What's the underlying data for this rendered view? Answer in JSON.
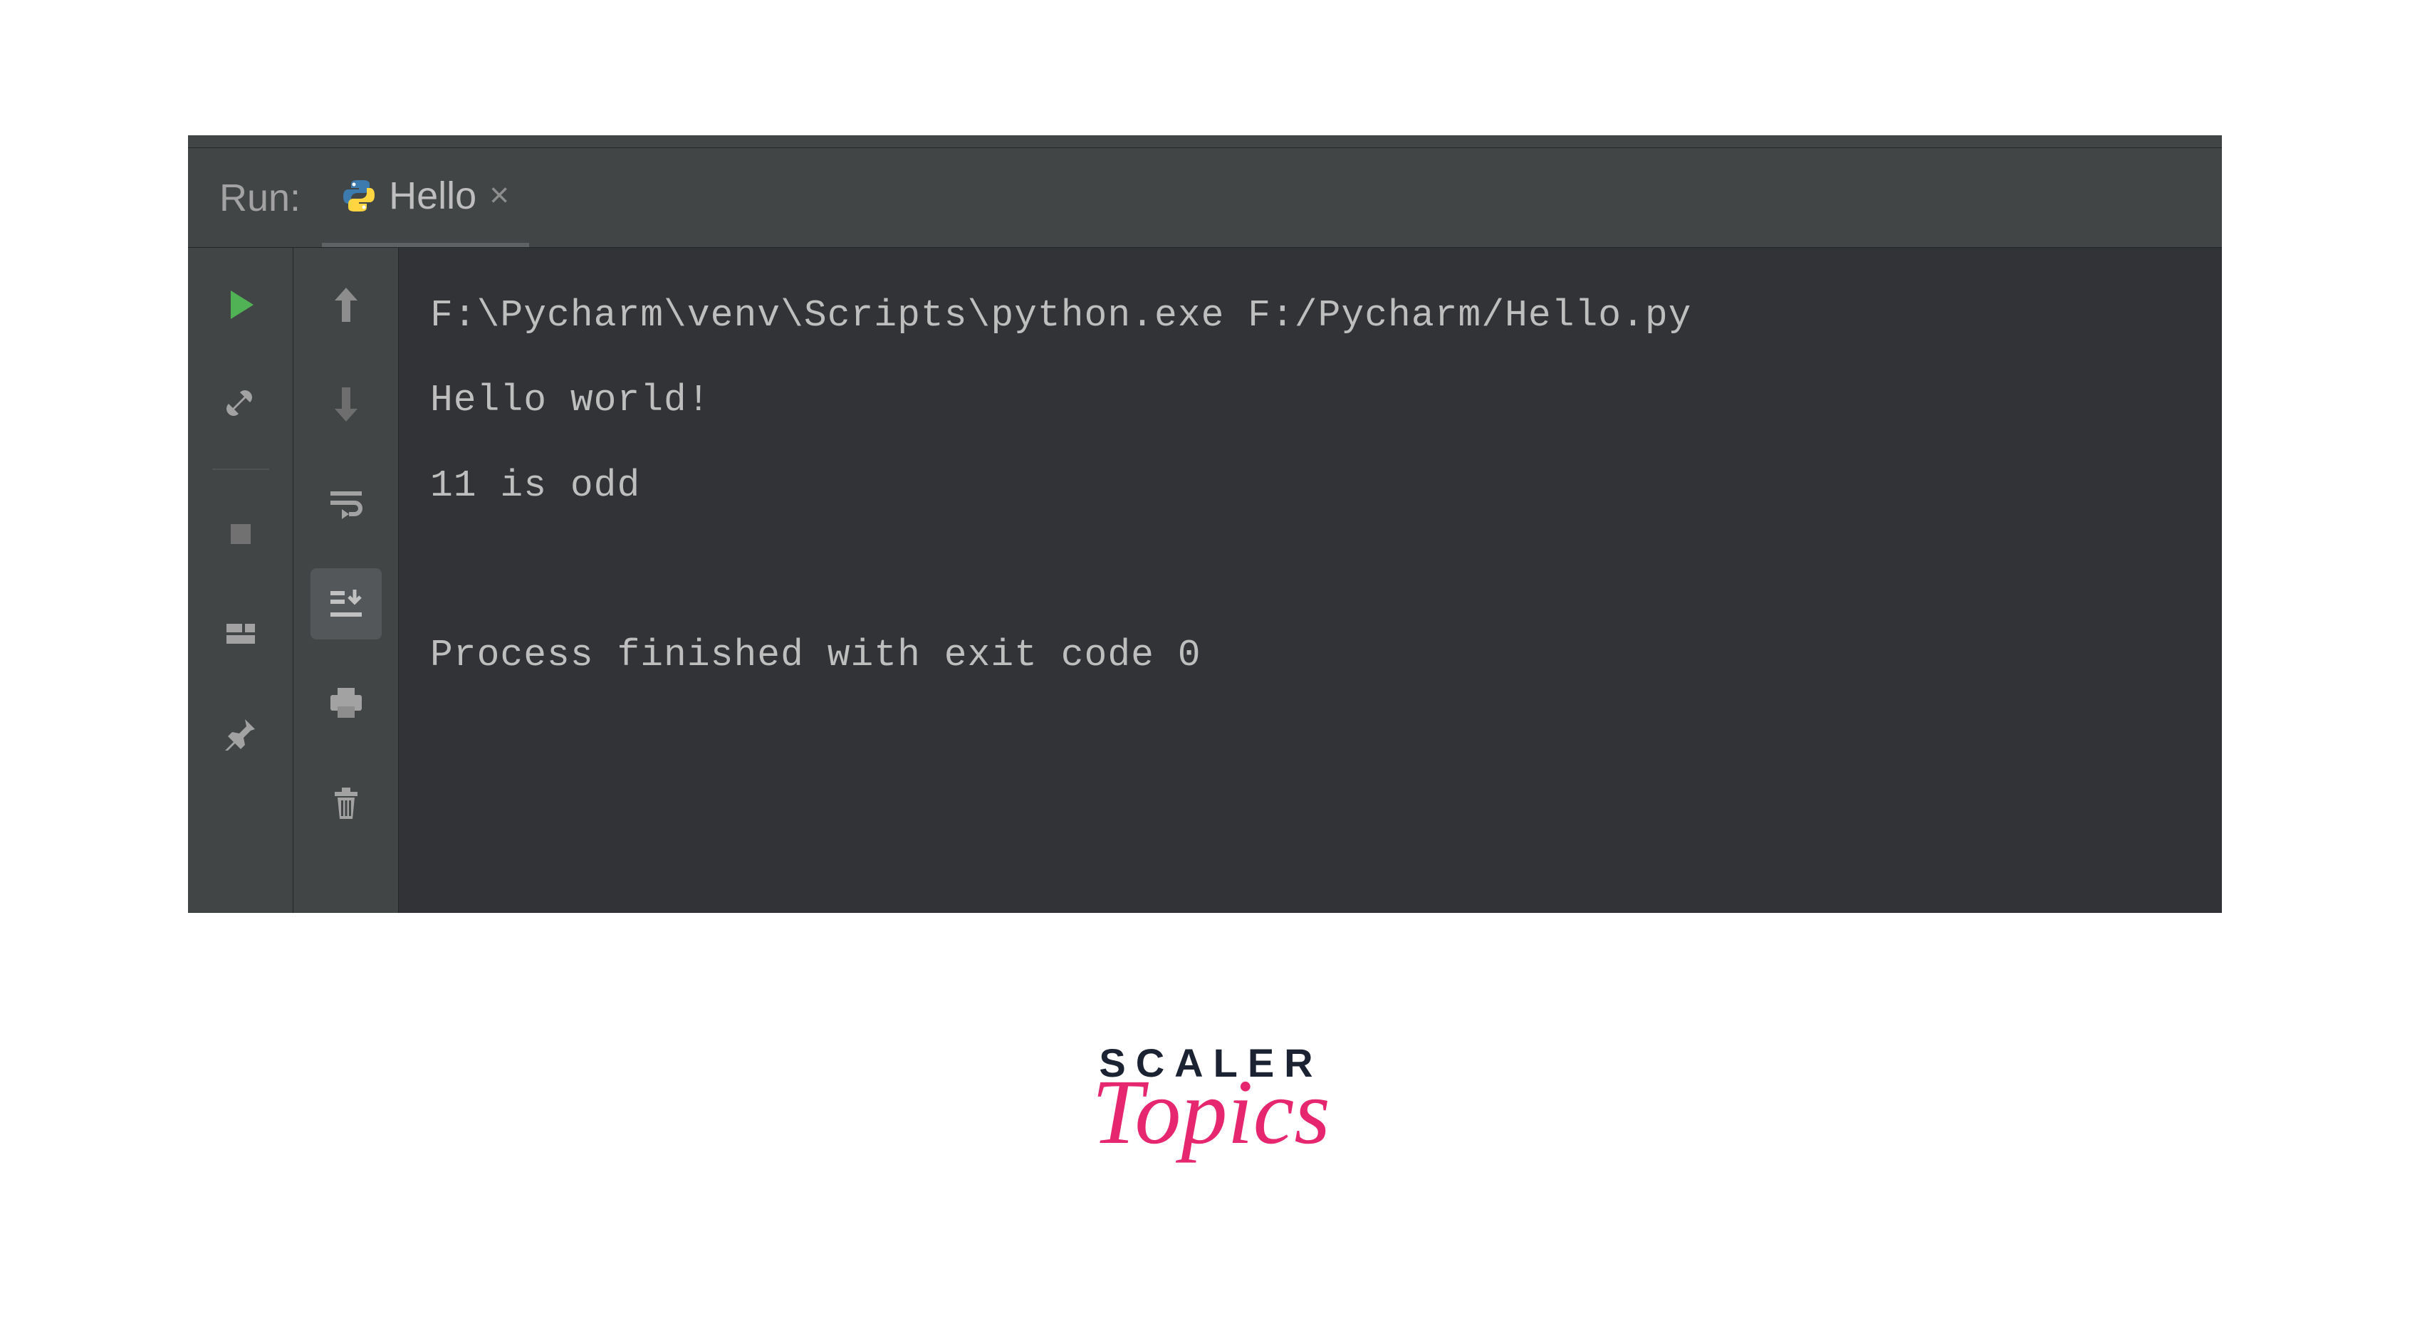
{
  "header": {
    "run_label": "Run:",
    "tab_name": "Hello"
  },
  "console": {
    "lines": [
      "F:\\Pycharm\\venv\\Scripts\\python.exe F:/Pycharm/Hello.py",
      "Hello world!",
      "11 is odd",
      "",
      "Process finished with exit code 0"
    ]
  },
  "logo": {
    "line1": "SCALER",
    "line2": "Topics"
  },
  "colors": {
    "bg_dark": "#2b2d30",
    "bg_panel": "#3c3f41",
    "text_muted": "#bcbcbc",
    "accent_green": "#4caf50",
    "logo_pink": "#e6276f",
    "logo_navy": "#1b2333"
  }
}
